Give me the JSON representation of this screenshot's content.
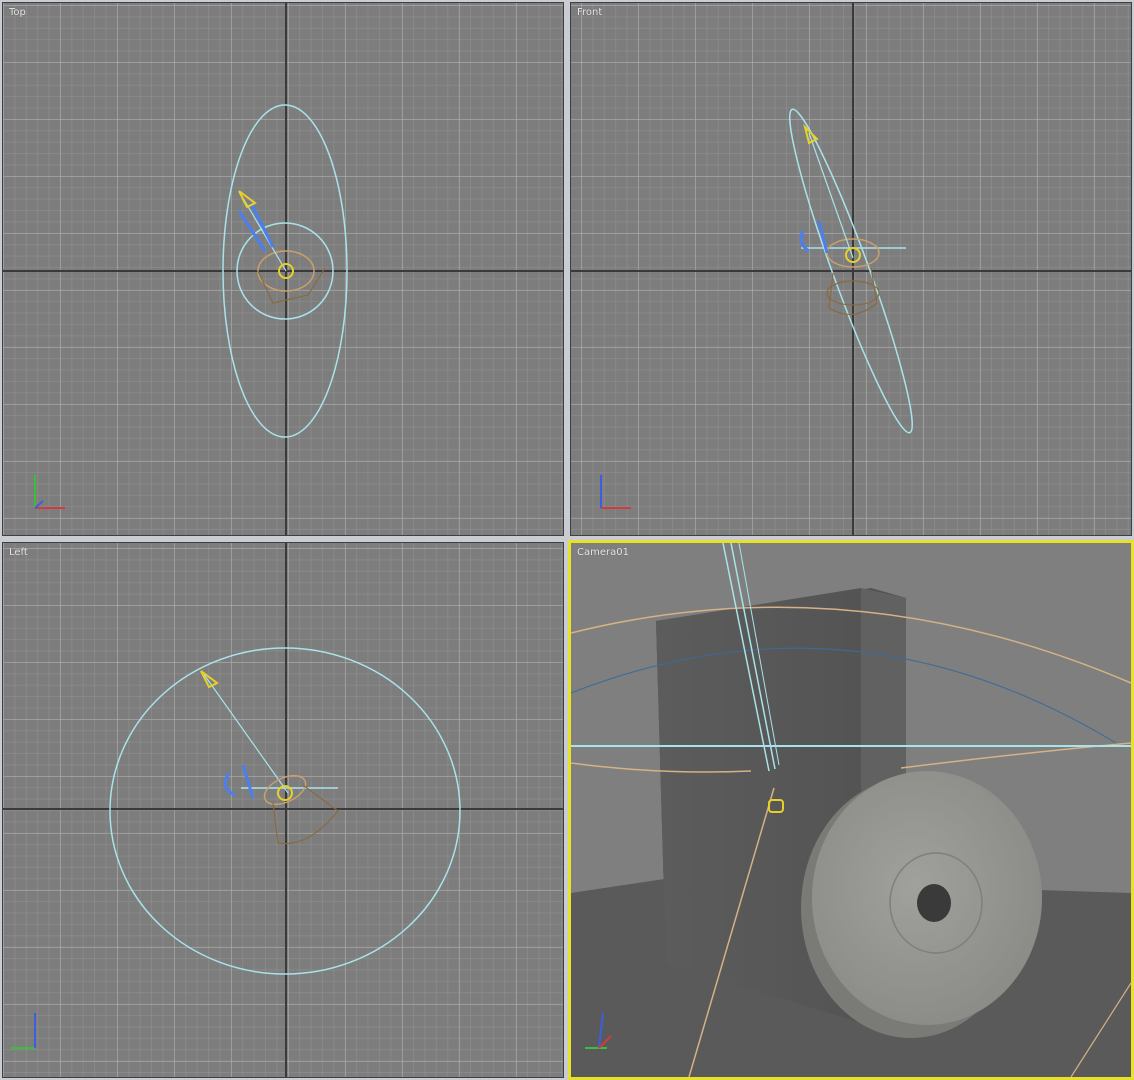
{
  "viewports": {
    "top": {
      "label": "Top"
    },
    "front": {
      "label": "Front"
    },
    "left": {
      "label": "Left"
    },
    "camera": {
      "label": "Camera01",
      "active": true
    }
  },
  "colors": {
    "viewport_bg": "#7d7d7d",
    "grid_major": "#3a3a3a",
    "helper_cyan": "#a9e3ea",
    "light_yellow": "#e6d12a",
    "light_cone_tan": "#c9a06a",
    "camera_blue": "#4a7ff0",
    "active_border": "#e8e12a",
    "axis_x": "#d23b3b",
    "axis_y": "#3bbf3b",
    "axis_z": "#3b5fe0"
  },
  "icons": {
    "axis_tripod": "axis-tripod-icon",
    "spotlight": "spotlight-icon",
    "camera": "camera-icon"
  }
}
